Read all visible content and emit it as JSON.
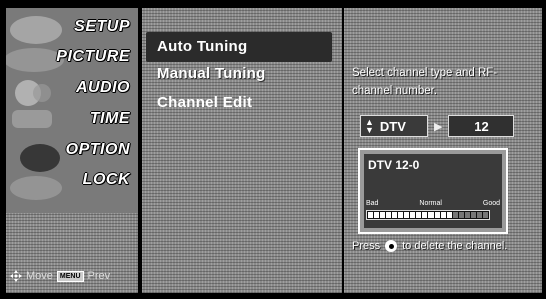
{
  "sidebar": {
    "items": [
      {
        "label": "SETUP"
      },
      {
        "label": "PICTURE"
      },
      {
        "label": "AUDIO"
      },
      {
        "label": "TIME"
      },
      {
        "label": "OPTION"
      },
      {
        "label": "LOCK"
      }
    ],
    "nav": {
      "move_icon": "move-arrows-icon",
      "move_label": "Move",
      "menu_key": "MENU",
      "prev_label": "Prev"
    }
  },
  "options": {
    "items": [
      {
        "label": "Auto Tuning"
      },
      {
        "label": "Manual Tuning"
      },
      {
        "label": "Channel Edit"
      }
    ],
    "selected": "Auto Tuning"
  },
  "detail": {
    "help_text": "Select channel type and RF-channel number.",
    "channel_type": "DTV",
    "channel_number": "12",
    "signal": {
      "title": "DTV 12-0",
      "label_bad": "Bad",
      "label_normal": "Normal",
      "label_good": "Good",
      "level": 0.72
    },
    "footer_prefix": "Press",
    "footer_suffix": "to delete the channel."
  }
}
